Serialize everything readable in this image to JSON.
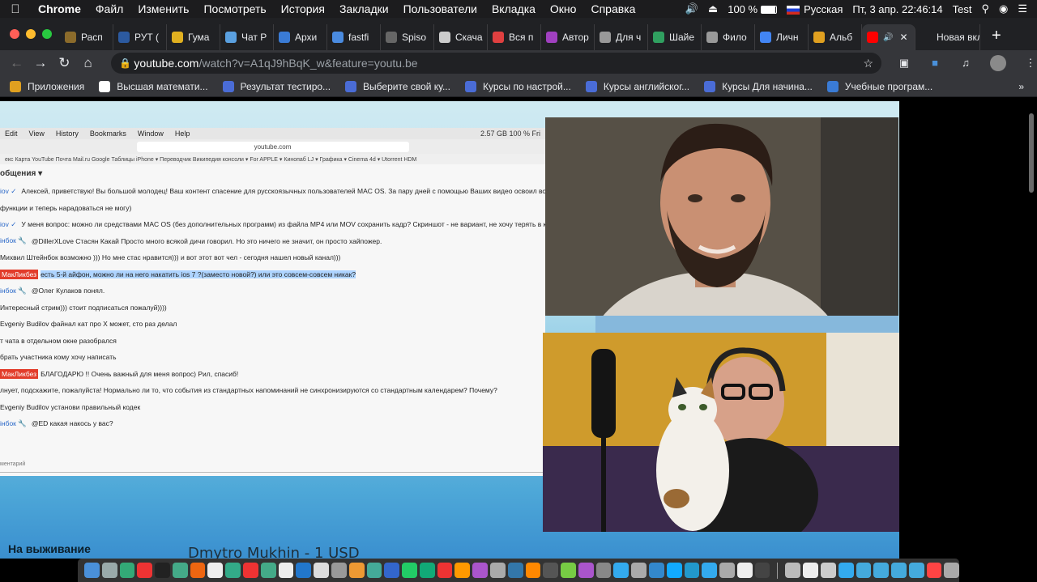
{
  "menubar": {
    "app": "Chrome",
    "items": [
      "Файл",
      "Изменить",
      "Посмотреть",
      "История",
      "Закладки",
      "Пользователи",
      "Вкладка",
      "Окно",
      "Справка"
    ],
    "battery": "100 %",
    "input_source": "Русская",
    "datetime": "Пт, 3 апр.  22:46:14",
    "user": "Test"
  },
  "tabs": [
    {
      "label": "Расп",
      "color": "#8b6b2b"
    },
    {
      "label": "РУТ (",
      "color": "#2c5aa0"
    },
    {
      "label": "Гума",
      "color": "#e0b020"
    },
    {
      "label": "Чат Р",
      "color": "#5aa0e0"
    },
    {
      "label": "Архи",
      "color": "#3a7bd5"
    },
    {
      "label": "fastfi",
      "color": "#4a8be0"
    },
    {
      "label": "Spiso",
      "color": "#666666"
    },
    {
      "label": "Скача",
      "color": "#cccccc"
    },
    {
      "label": "Вся п",
      "color": "#e04040"
    },
    {
      "label": "Автор",
      "color": "#a040c0"
    },
    {
      "label": "Для ч",
      "color": "#999999"
    },
    {
      "label": "Шайе",
      "color": "#30a060"
    },
    {
      "label": "Фило",
      "color": "#999999"
    },
    {
      "label": "Личн",
      "color": "#4285f4"
    },
    {
      "label": "Альб",
      "color": "#e0a020"
    },
    {
      "label": "",
      "color": "#ff0000",
      "active": true
    },
    {
      "label": "Новая вкл",
      "color": "#202124"
    }
  ],
  "address": {
    "host": "youtube.com",
    "path": "/watch?v=A1qJ9hBqK_w&feature=youtu.be"
  },
  "bookmarks": [
    {
      "label": "Приложения",
      "color": "#e0a020"
    },
    {
      "label": "Высшая математи...",
      "color": "#ffffff"
    },
    {
      "label": "Результат тестиро...",
      "color": "#4a6cd6"
    },
    {
      "label": "Выберите свой ку...",
      "color": "#4a6cd6"
    },
    {
      "label": "Курсы по настрой...",
      "color": "#4a6cd6"
    },
    {
      "label": "Курсы английског...",
      "color": "#4a6cd6"
    },
    {
      "label": "Курсы Для начина...",
      "color": "#4a6cd6"
    },
    {
      "label": "Учебные програм...",
      "color": "#3a7bd5"
    }
  ],
  "shared_screen": {
    "menu": [
      "Edit",
      "View",
      "History",
      "Bookmarks",
      "Window",
      "Help"
    ],
    "status": "2.57 GB   100 %   Fri",
    "url": "youtube.com",
    "bookmarks": "екс   Карта   YouTube   Почта Mail.ru   Google Таблицы   iPhone ▾   Переводчик   Википедия   консоли ▾   For APPLE ▾   Кинопаб   LJ ▾   Графика ▾   Cinema 4d ▾   Utorrent HDM",
    "chat_header": "общения ▾",
    "chat": [
      {
        "name": "іov ✓",
        "text": "Алексей, приветствую! Вы большой молодец! Ваш контент спасение для русскоязычных пользователей MAC OS. За пару дней с помощью Ваших видео освоил во"
      },
      {
        "name": "",
        "text": "функции и теперь нарадоваться не могу)"
      },
      {
        "name": "іov ✓",
        "text": "У меня вопрос: можно ли средствами MAC OS (без дополнительных программ) из файла MP4 или MOV сохранить кадр? Скриншот - не вариант, не хочу терять в к"
      },
      {
        "name": "інбок 🔧",
        "text": "@DillerXLove Стасян Какай Просто много всякой дичи говорил. Но это ничего не значит, он просто хайпожер."
      },
      {
        "name": "",
        "text": "Михвил Штейнбок возможно ))) Но мне стас нравится))) и вот этот вот чел - сегодня нашел новый канал)))"
      },
      {
        "name": "МакЛикбез",
        "badge": true,
        "text": "есть 5-й айфон, можно ли на него накатить ios 7 ?(заместо новой?) или это совсем-совсем никак?"
      },
      {
        "name": "інбок 🔧",
        "text": "@Олег Кулаков понял."
      },
      {
        "name": "",
        "text": "Интересный стрим))) стоит подписаться пожалуй))))"
      },
      {
        "name": "",
        "text": "Evgeniy Budilov файнал кат про Х может, сто раз делал"
      },
      {
        "name": "",
        "text": "т чата в отдельном окне разобрался"
      },
      {
        "name": "",
        "text": "брать участника кому хочу написать"
      },
      {
        "name": "МакЛикбез",
        "badge": true,
        "text": "БЛАГОДАРЮ !! Очень важный для меня вопрос) Рил, спасиб!"
      },
      {
        "name": "",
        "text": "лнует, подскажите, пожалуйста! Нормально ли то, что события из стандартных напоминаний не синхронизируются со стандартным календарем? Почему?"
      },
      {
        "name": "",
        "text": "Evgeniy Budilov установи правильный кодек"
      },
      {
        "name": "інбок 🔧",
        "text": "@ED какая накось у вас?"
      }
    ],
    "comment_placeholder": "ментарий"
  },
  "overlay": {
    "caption": "Dmytro Mukhin - 1 USD",
    "lower_left": "На выживание"
  },
  "dock_apps": [
    "#4a90d9",
    "#9aa",
    "#3a7",
    "#e33",
    "#222",
    "#4a8",
    "#e61",
    "#eee",
    "#3a8",
    "#e33",
    "#4a8",
    "#eee",
    "#27c",
    "#ddd",
    "#999",
    "#e93",
    "#4a9",
    "#36c",
    "#2c6",
    "#1a7",
    "#e33",
    "#f90",
    "#a5c",
    "#aaa",
    "#37a",
    "#f80",
    "#555",
    "#7c4",
    "#a5c",
    "#888",
    "#3ae",
    "#aaa",
    "#38c",
    "#1af",
    "#29c",
    "#3ae",
    "#aaa",
    "#eee",
    "#444",
    "#bbb",
    "#eee",
    "#ccc",
    "#3ae",
    "#4ad",
    "#4ad",
    "#4ad",
    "#4ad",
    "#f44",
    "#aaa"
  ]
}
